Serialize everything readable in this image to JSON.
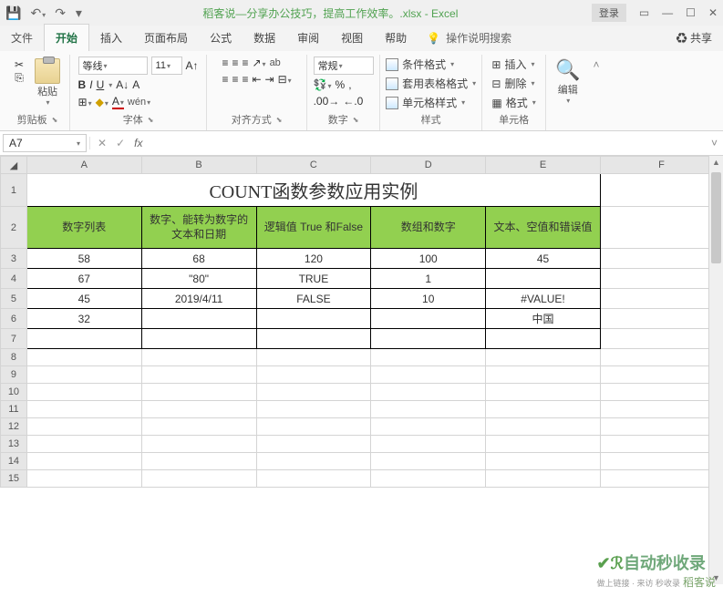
{
  "titlebar": {
    "doc_title": "稻客说—分享办公技巧，提高工作效率。.xlsx - Excel",
    "login": "登录"
  },
  "tabs": {
    "file": "文件",
    "home": "开始",
    "insert": "插入",
    "layout": "页面布局",
    "formulas": "公式",
    "data": "数据",
    "review": "审阅",
    "view": "视图",
    "help": "帮助",
    "tellme": "操作说明搜索",
    "share": "共享"
  },
  "ribbon": {
    "paste": "粘贴",
    "clipboard": "剪贴板",
    "font_name": "等线",
    "font_size": "11",
    "font_group": "字体",
    "align_group": "对齐方式",
    "number_format": "常规",
    "number_group": "数字",
    "cond_fmt": "条件格式",
    "table_fmt": "套用表格格式",
    "cell_style": "单元格样式",
    "styles_group": "样式",
    "insert_btn": "插入",
    "delete_btn": "删除",
    "format_btn": "格式",
    "cells_group": "单元格",
    "editing": "编辑"
  },
  "namebox": "A7",
  "columns": [
    "A",
    "B",
    "C",
    "D",
    "E",
    "F"
  ],
  "row_headers": [
    "1",
    "2",
    "3",
    "4",
    "5",
    "6",
    "7",
    "8",
    "9",
    "10",
    "11",
    "12",
    "13",
    "14",
    "15"
  ],
  "sheet": {
    "title": "COUNT函数参数应用实例",
    "headers": [
      "数字列表",
      "数字、能转为数字的文本和日期",
      "逻辑值 True 和False",
      "数组和数字",
      "文本、空值和错误值"
    ],
    "rows": [
      [
        "58",
        "68",
        "120",
        "100",
        "45"
      ],
      [
        "67",
        "\"80\"",
        "TRUE",
        "1",
        ""
      ],
      [
        "45",
        "2019/4/11",
        "FALSE",
        "10",
        "#VALUE!"
      ],
      [
        "32",
        "",
        "",
        "",
        "中国"
      ],
      [
        "",
        "",
        "",
        "",
        ""
      ]
    ]
  },
  "watermark": {
    "logo": "自动秒收录",
    "sub": "做上链接 · 来访 秒收录",
    "brand": "稻客说"
  }
}
